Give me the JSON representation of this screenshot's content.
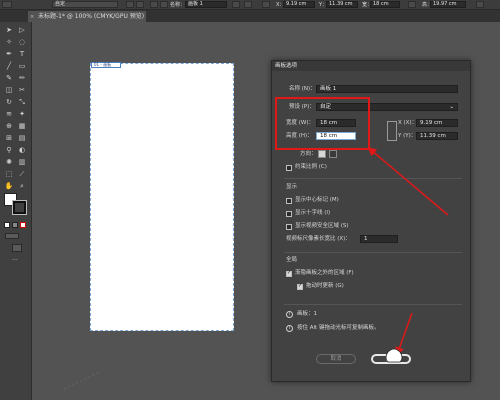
{
  "top_bar": {
    "mode_label": "自定",
    "name_label": "名称：",
    "name_value": "画板 1",
    "x_label": "X：",
    "x_value": "9.19 cm",
    "y_label": "Y：",
    "y_value": "11.39 cm",
    "w_label": "宽：",
    "w_value": "18 cm",
    "h_label": "高：",
    "h_value": "19.97 cm"
  },
  "tab": {
    "title": "未标题-1* @ 100% (CMYK/GPU 预览)",
    "close": "×"
  },
  "artboard": {
    "label": "01 - 画板"
  },
  "dialog": {
    "title": "画板选项",
    "name_label": "名称 (N)：",
    "name_value": "画板 1",
    "preset_label": "预设 (P)：",
    "preset_value": "自定",
    "width_label": "宽度 (W)：",
    "width_value": "18 cm",
    "height_label": "高度 (H)：",
    "height_value": "18 cm",
    "x_label": "X (X)：",
    "x_value": "9.19 cm",
    "y_label": "Y (Y)：",
    "y_value": "11.39 cm",
    "orientation_label": "方向：",
    "constrain_label": "约束比例 (C)",
    "display_section": "显示",
    "show_center_label": "显示中心标记 (M)",
    "show_cross_label": "显示十字线 (I)",
    "show_safe_label": "显示视频安全区域 (S)",
    "pixel_ratio_label": "视频标尺像素长宽比 (X)：",
    "pixel_ratio_value": "1",
    "global_section": "全局",
    "fade_label": "渐隐画板之外的区域 (F)",
    "update_drag_label": "拖动时更新 (G)",
    "artboards_label": "画板：1",
    "hint_text": "按住 Alt 键拖动光标可复制画板。",
    "cancel_label": "取消",
    "ok_label": "确定"
  },
  "colors": {
    "annotation": "#e01818"
  }
}
